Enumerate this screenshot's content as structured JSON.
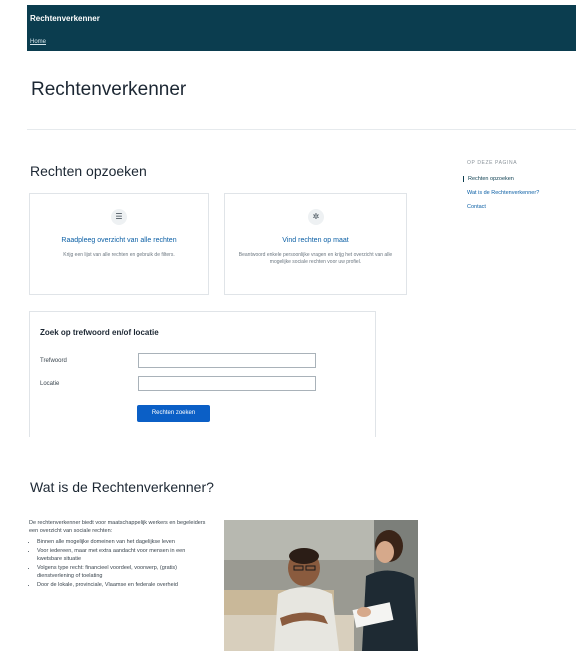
{
  "header": {
    "brand": "Rechtenverkenner",
    "home": "Home"
  },
  "page_title": "Rechtenverkenner",
  "search_section": {
    "title": "Rechten opzoeken",
    "cards": [
      {
        "icon": "list-icon",
        "title": "Raadpleeg overzicht van alle rechten",
        "desc": "Krijg een lijst van alle rechten en gebruik de filters."
      },
      {
        "icon": "gear-icon",
        "title": "Vind rechten op maat",
        "desc": "Beantwoord enkele persoonlijke vragen en krijg het overzicht van alle mogelijke sociale rechten voor uw profiel."
      }
    ],
    "form": {
      "title": "Zoek op trefwoord en/of locatie",
      "keyword_label": "Trefwoord",
      "keyword_value": "",
      "location_label": "Locatie",
      "location_value": "",
      "button": "Rechten zoeken"
    }
  },
  "toc": {
    "heading": "OP DEZE PAGINA",
    "items": [
      "Rechten opzoeken",
      "Wat is de Rechtenverkenner?",
      "Contact"
    ]
  },
  "about": {
    "title": "Wat is de Rechtenverkenner?",
    "intro": "De rechtenverkenner biedt voor maatschappelijk werkers en begeleiders een overzicht van sociale rechten:",
    "bullets": [
      "Binnen alle mogelijke domeinen van het dagelijkse leven",
      "Voor iedereen, maar met extra aandacht voor mensen in een kwetsbare situatie",
      "Volgens type recht: financieel voordeel, voorwerp, (gratis) dienstverlening of toelating",
      "Door de lokale, provinciale, Vlaamse en federale overheid"
    ]
  },
  "colors": {
    "header_bg": "#0b3d4f",
    "link": "#0b5fa5",
    "button": "#0b5fc6"
  }
}
